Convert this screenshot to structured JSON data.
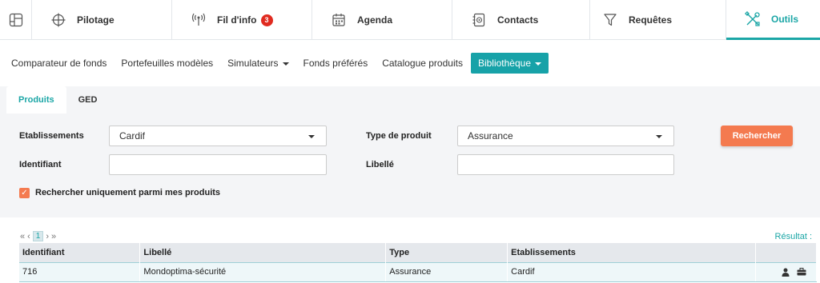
{
  "nav": {
    "tabs": [
      {
        "label": "Pilotage",
        "icon": "crosshair-icon"
      },
      {
        "label": "Fil d'info",
        "icon": "antenna-icon",
        "badge": "3"
      },
      {
        "label": "Agenda",
        "icon": "calendar-icon"
      },
      {
        "label": "Contacts",
        "icon": "contact-book-icon"
      },
      {
        "label": "Requêtes",
        "icon": "funnel-icon"
      },
      {
        "label": "Outils",
        "icon": "tools-icon",
        "active": true
      }
    ]
  },
  "subnav": {
    "items": [
      {
        "label": "Comparateur de fonds"
      },
      {
        "label": "Portefeuilles modèles"
      },
      {
        "label": "Simulateurs",
        "dropdown": true
      },
      {
        "label": "Fonds préférés"
      },
      {
        "label": "Catalogue produits"
      },
      {
        "label": "Bibliothèque",
        "dropdown": true,
        "active": true
      }
    ]
  },
  "panel": {
    "tabs": [
      {
        "label": "Produits",
        "active": true
      },
      {
        "label": "GED"
      }
    ]
  },
  "form": {
    "etablissements_label": "Etablissements",
    "etablissements_value": "Cardif",
    "type_label": "Type de produit",
    "type_value": "Assurance",
    "identifiant_label": "Identifiant",
    "identifiant_value": "",
    "libelle_label": "Libellé",
    "libelle_value": "",
    "search_label": "Rechercher",
    "only_mine_label": "Rechercher uniquement parmi mes produits",
    "only_mine_checked": true
  },
  "results": {
    "pager": {
      "first": "«",
      "prev": "‹",
      "page": "1",
      "next": "›",
      "last": "»"
    },
    "result_label": "Résultat :",
    "columns": [
      "Identifiant",
      "Libellé",
      "Type",
      "Etablissements",
      ""
    ],
    "rows": [
      [
        "716",
        "Mondoptima-sécurité",
        "Assurance",
        "Cardif"
      ]
    ]
  },
  "colors": {
    "accent": "#1ba6a6",
    "search_button": "#f47a4f",
    "badge": "#e02b20"
  }
}
